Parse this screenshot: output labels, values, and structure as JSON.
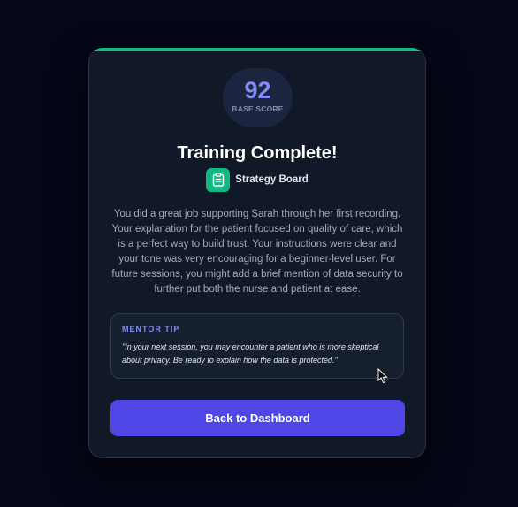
{
  "score": {
    "value": "92",
    "label": "BASE SCORE"
  },
  "title": "Training Complete!",
  "board": {
    "label": "Strategy Board",
    "icon": "clipboard-icon"
  },
  "feedback": "You did a great job supporting Sarah through her first recording. Your explanation for the patient focused on quality of care, which is a perfect way to build trust. Your instructions were clear and your tone was very encouraging for a beginner-level user. For future sessions, you might add a brief mention of data security to further put both the nurse and patient at ease.",
  "mentor_tip": {
    "heading": "MENTOR TIP",
    "text": "\"In your next session, you may encounter a patient who is more skeptical about privacy. Be ready to explain how the data is protected.\""
  },
  "actions": {
    "back_label": "Back to Dashboard"
  },
  "colors": {
    "accent_green": "#10b981",
    "accent_indigo": "#4f46e5",
    "score_text": "#818cf8",
    "card_bg": "#111827",
    "page_bg": "#030716"
  }
}
